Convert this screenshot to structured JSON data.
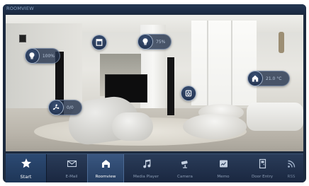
{
  "titlebar": {
    "text": "ROOMVIEW"
  },
  "controls": {
    "light_left": {
      "icon": "light-bulb-icon",
      "value": "100%"
    },
    "blind": {
      "icon": "blind-icon"
    },
    "light_center": {
      "icon": "light-bulb-icon",
      "value": "75%"
    },
    "fan": {
      "icon": "fan-icon",
      "value": "0/0"
    },
    "speaker": {
      "icon": "speaker-icon"
    },
    "climate": {
      "icon": "home-icon",
      "value": "21.0 °C"
    }
  },
  "dock": {
    "start": {
      "label": "Start",
      "icon": "star-icon"
    },
    "items": [
      {
        "label": "E-Mail",
        "icon": "mail-icon"
      },
      {
        "label": "Roomview",
        "icon": "roomview-icon"
      },
      {
        "label": "Media Player",
        "icon": "music-note-icon"
      },
      {
        "label": "Camera",
        "icon": "camera-icon"
      },
      {
        "label": "Memo",
        "icon": "memo-icon"
      },
      {
        "label": "Door Entry",
        "icon": "door-icon"
      },
      {
        "label": "RSS",
        "icon": "rss-icon"
      }
    ]
  },
  "colors": {
    "accent": "#2c4a73",
    "panel": "#1c2a3e",
    "pill": "#26344e",
    "label_inactive": "#8b9cb4"
  }
}
